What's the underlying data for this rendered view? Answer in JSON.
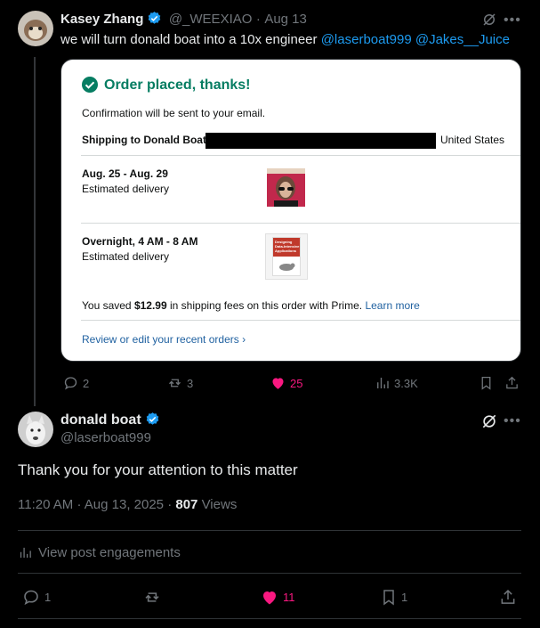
{
  "tweet1": {
    "author_name": "Kasey Zhang",
    "handle": "@_WEEXIAO",
    "separator": "·",
    "date": "Aug 13",
    "text": "we will turn donald boat into a 10x engineer",
    "mentions": [
      "@laserboat999",
      "@Jakes__Juice"
    ],
    "card": {
      "title": "Order placed, thanks!",
      "confirmation": "Confirmation will be sent to your email.",
      "shipping_label": "Shipping to Donald Boat,",
      "shipping_country": "United States",
      "delivery1_dates": "Aug. 25 - Aug. 29",
      "delivery1_note": "Estimated delivery",
      "delivery2_dates": "Overnight, 4 AM - 8 AM",
      "delivery2_note": "Estimated delivery",
      "savings_prefix": "You saved",
      "savings_amount": "$12.99",
      "savings_suffix": "in shipping fees on this order with Prime.",
      "learn_more": "Learn more",
      "review_link": "Review or edit your recent orders ›",
      "book2_title_lines": [
        "Designing",
        "Data-Intensive",
        "Applications"
      ]
    },
    "actions": {
      "replies": "2",
      "reposts": "3",
      "likes": "25",
      "views": "3.3K"
    },
    "colors": {
      "like": "#f91880",
      "link": "#1d9bf0",
      "success": "#067d62"
    }
  },
  "tweet2": {
    "author_name": "donald boat",
    "handle": "@laserboat999",
    "text": "Thank you for your attention to this matter",
    "time": "11:20 AM",
    "date_sep": "·",
    "date": "Aug 13, 2025",
    "views_sep": "·",
    "views_count": "807",
    "views_label": "Views",
    "engagements_label": "View post engagements",
    "actions": {
      "replies": "1",
      "likes": "11",
      "bookmarks": "1"
    }
  }
}
